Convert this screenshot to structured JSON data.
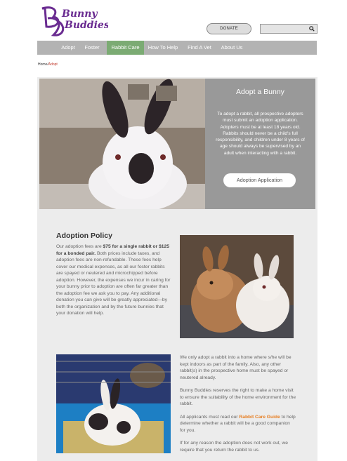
{
  "header": {
    "logo_text_1": "Bunny",
    "logo_text_2": "Buddies",
    "donate_label": "DONATE",
    "search_placeholder": ""
  },
  "nav": {
    "items": [
      {
        "label": "Adopt"
      },
      {
        "label": "Foster"
      },
      {
        "label": "Rabbit Care"
      },
      {
        "label": "How To Help"
      },
      {
        "label": "Find A Vet"
      },
      {
        "label": "About Us"
      }
    ],
    "active": "Rabbit Care"
  },
  "breadcrumb": {
    "home": "Home",
    "separator": "/",
    "current": "Adopt"
  },
  "hero": {
    "title": "Adopt a Bunny",
    "text": "To adopt a rabbit, all prospective adopters must submit an adoption application. Adopters must be at least 18 years old. Rabbits should never be a child's full responsibility, and children under 8 years of age should always be supervised by an adult when interacting with a rabbit.",
    "button_label": "Adoption  Application"
  },
  "policy": {
    "title": "Adoption Policy",
    "text_1": "Our adoption fees are ",
    "fee_bold": "$75 for a single rabbit or $125 for a bonded pair.",
    "text_2": " Both prices include taxes, and adoption fees are non-refundable. These fees help cover our medical expenses, as all our foster rabbits are spayed or neutered and microchipped before adoption. However, the expenses we incur in caring for your bunny prior to adoption are often far greater than the adoption fee we ask you to pay. Any additional donation you can give will be greatly appreciated—by both the organization and by the future bunnies that your donation will help."
  },
  "info": {
    "para_1": "We only adopt a rabbit into a home where s/he will be kept indoors as part of the family. Also, any other rabbit(s) in the prospective home must be spayed or neutered already.",
    "para_2": "Bunny Buddies reserves the right to make a home visit to ensure the suitability of the home environment for the rabbit.",
    "para_3_pre": "All applicants must read our ",
    "para_3_link": "Rabbit Care Guide",
    "para_3_post": " to help determine whether a rabbit will be a good companion for you.",
    "para_4": "If for any reason the adoption does not work out, we require that you return the rabbit to us."
  },
  "colors": {
    "brand_purple": "#6a2c91",
    "nav_gray": "#b3b3b3",
    "nav_active_green": "#7bab73",
    "link_orange": "#e67e22"
  }
}
